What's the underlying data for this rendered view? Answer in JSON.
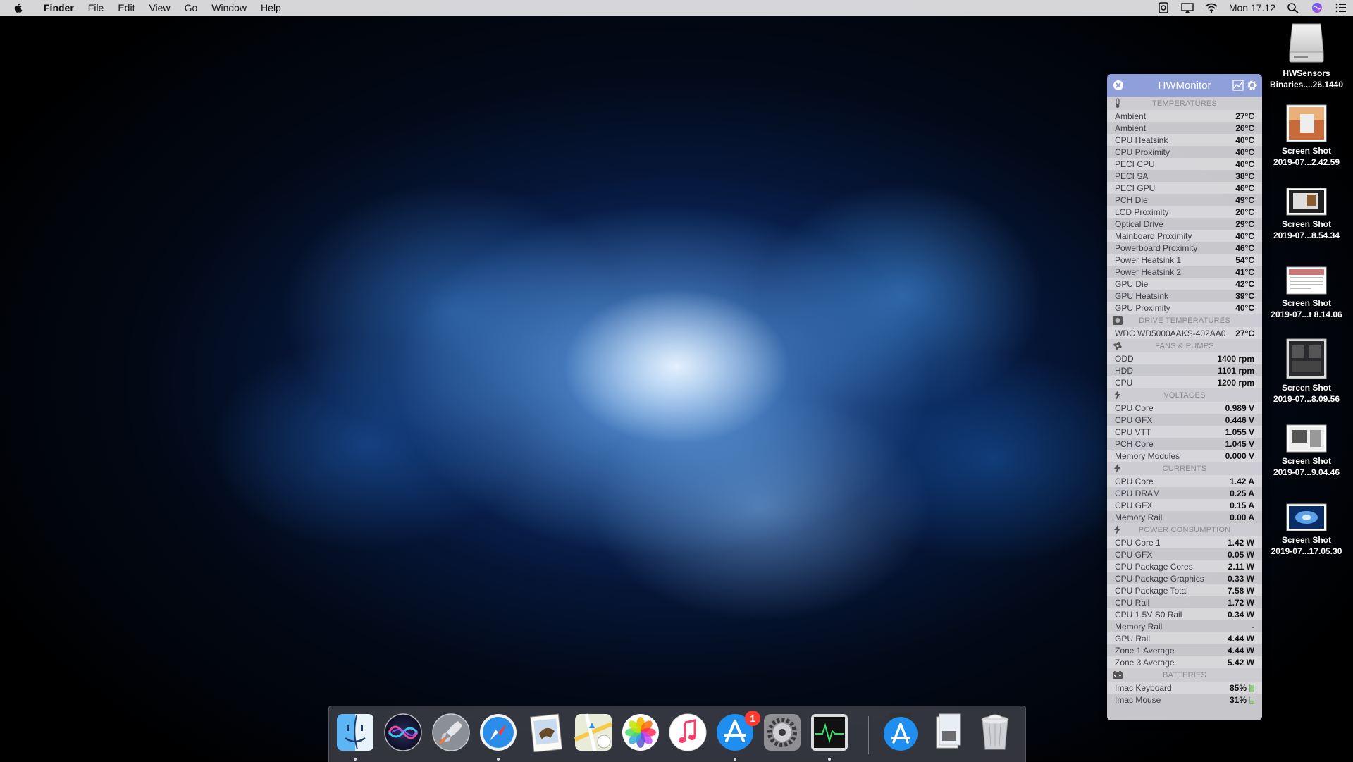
{
  "menubar": {
    "app_name": "Finder",
    "items": [
      "File",
      "Edit",
      "View",
      "Go",
      "Window",
      "Help"
    ],
    "clock": "Mon 17.12"
  },
  "hwmonitor": {
    "title": "HWMonitor",
    "sections": {
      "temperatures": {
        "title": "TEMPERATURES",
        "rows": [
          {
            "label": "Ambient",
            "value": "27°C"
          },
          {
            "label": "Ambient",
            "value": "26°C"
          },
          {
            "label": "CPU Heatsink",
            "value": "40°C"
          },
          {
            "label": "CPU Proximity",
            "value": "40°C"
          },
          {
            "label": "PECI CPU",
            "value": "40°C"
          },
          {
            "label": "PECI SA",
            "value": "38°C"
          },
          {
            "label": "PECI GPU",
            "value": "46°C"
          },
          {
            "label": "PCH Die",
            "value": "49°C"
          },
          {
            "label": "LCD Proximity",
            "value": "20°C"
          },
          {
            "label": "Optical Drive",
            "value": "29°C"
          },
          {
            "label": "Mainboard Proximity",
            "value": "40°C"
          },
          {
            "label": "Powerboard Proximity",
            "value": "46°C"
          },
          {
            "label": "Power Heatsink 1",
            "value": "54°C"
          },
          {
            "label": "Power Heatsink 2",
            "value": "41°C"
          },
          {
            "label": "GPU Die",
            "value": "42°C"
          },
          {
            "label": "GPU Heatsink",
            "value": "39°C"
          },
          {
            "label": "GPU Proximity",
            "value": "40°C"
          }
        ]
      },
      "drive_temperatures": {
        "title": "DRIVE TEMPERATURES",
        "rows": [
          {
            "label": "WDC WD5000AAKS-402AA0",
            "value": "27°C"
          }
        ]
      },
      "fans": {
        "title": "FANS & PUMPS",
        "rows": [
          {
            "label": "ODD",
            "value": "1400 rpm"
          },
          {
            "label": "HDD",
            "value": "1101 rpm"
          },
          {
            "label": "CPU",
            "value": "1200 rpm"
          }
        ]
      },
      "voltages": {
        "title": "VOLTAGES",
        "rows": [
          {
            "label": "CPU Core",
            "value": "0.989 V"
          },
          {
            "label": "CPU GFX",
            "value": "0.446 V"
          },
          {
            "label": "CPU VTT",
            "value": "1.055 V"
          },
          {
            "label": "PCH Core",
            "value": "1.045 V"
          },
          {
            "label": "Memory Modules",
            "value": "0.000 V"
          }
        ]
      },
      "currents": {
        "title": "CURRENTS",
        "rows": [
          {
            "label": "CPU Core",
            "value": "1.42 A"
          },
          {
            "label": "CPU DRAM",
            "value": "0.25 A"
          },
          {
            "label": "CPU GFX",
            "value": "0.15 A"
          },
          {
            "label": "Memory Rail",
            "value": "0.00 A"
          }
        ]
      },
      "power": {
        "title": "POWER CONSUMPTION",
        "rows": [
          {
            "label": "CPU Core 1",
            "value": "1.42 W"
          },
          {
            "label": "CPU GFX",
            "value": "0.05 W"
          },
          {
            "label": "CPU Package Cores",
            "value": "2.11 W"
          },
          {
            "label": "CPU Package Graphics",
            "value": "0.33 W"
          },
          {
            "label": "CPU Package Total",
            "value": "7.58 W"
          },
          {
            "label": "CPU Rail",
            "value": "1.72 W"
          },
          {
            "label": "CPU 1.5V S0 Rail",
            "value": "0.34 W"
          },
          {
            "label": "Memory Rail",
            "value": "-"
          },
          {
            "label": "GPU Rail",
            "value": "4.44 W"
          },
          {
            "label": "Zone 1 Average",
            "value": "4.44 W"
          },
          {
            "label": "Zone 3 Average",
            "value": "5.42 W"
          }
        ]
      },
      "batteries": {
        "title": "BATTERIES",
        "rows": [
          {
            "label": "Imac Keyboard",
            "value": "85%",
            "level": 0.85
          },
          {
            "label": "Imac Mouse",
            "value": "31%",
            "level": 0.31
          }
        ]
      }
    }
  },
  "desktop": {
    "items": [
      {
        "line1": "HWSensors",
        "line2": "Binaries....26.1440",
        "icon": "drive-icon"
      },
      {
        "line1": "Screen Shot",
        "line2": "2019-07...2.42.59",
        "icon": "screenshot-thumb"
      },
      {
        "line1": "Screen Shot",
        "line2": "2019-07...8.54.34",
        "icon": "screenshot-thumb"
      },
      {
        "line1": "Screen Shot",
        "line2": "2019-07...t 8.14.06",
        "icon": "screenshot-thumb"
      },
      {
        "line1": "Screen Shot",
        "line2": "2019-07...8.09.56",
        "icon": "screenshot-thumb"
      },
      {
        "line1": "Screen Shot",
        "line2": "2019-07...9.04.46",
        "icon": "screenshot-thumb"
      },
      {
        "line1": "Screen Shot",
        "line2": "2019-07...17.05.30",
        "icon": "screenshot-thumb"
      }
    ]
  },
  "dock": {
    "apps": [
      {
        "name": "finder-icon",
        "running": true
      },
      {
        "name": "siri-icon",
        "running": false
      },
      {
        "name": "launchpad-icon",
        "running": false
      },
      {
        "name": "safari-icon",
        "running": true
      },
      {
        "name": "mail-icon",
        "running": false
      },
      {
        "name": "maps-icon",
        "running": false
      },
      {
        "name": "photos-icon",
        "running": false
      },
      {
        "name": "itunes-icon",
        "running": false
      },
      {
        "name": "app-store-icon",
        "running": true,
        "badge": "1"
      },
      {
        "name": "system-preferences-icon",
        "running": false
      },
      {
        "name": "activity-monitor-icon",
        "running": true
      },
      {
        "name": "downloads-stack-icon",
        "running": false
      },
      {
        "name": "documents-stack-icon",
        "running": false
      },
      {
        "name": "trash-icon",
        "running": false
      }
    ]
  },
  "colors": {
    "hw_titlebar": "#8f9fd9",
    "badge": "#ff3b30",
    "battery_fill": "#8ad27a"
  }
}
